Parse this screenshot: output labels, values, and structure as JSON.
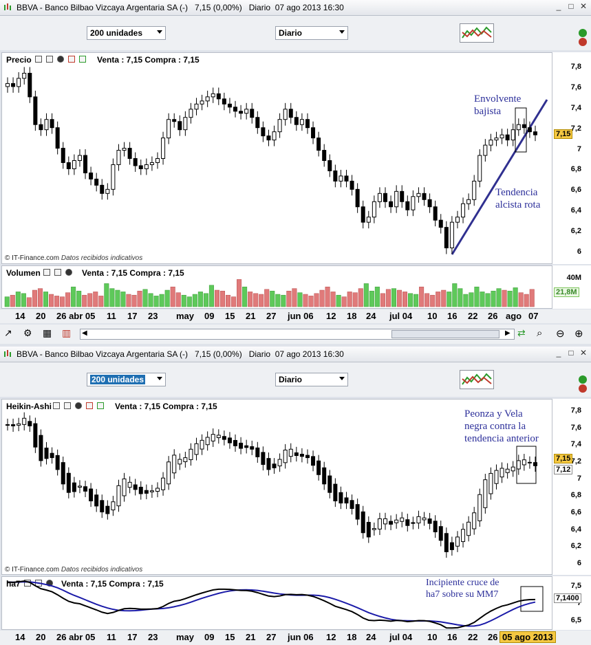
{
  "window1": {
    "title": "BBVA - Banco Bilbao Vizcaya Argentaria SA (-)   7,15 (0,00%)   Diario  07 ago 2013 16:30"
  },
  "window2": {
    "title": "BBVA - Banco Bilbao Vizcaya Argentaria SA (-)   7,15 (0,00%)   Diario  07 ago 2013 16:30"
  },
  "toolbar": {
    "units": "200 unidades",
    "period": "Diario"
  },
  "price_panel": {
    "header": "Precio",
    "quote": "Venta : 7,15 Compra : 7,15",
    "copyright": "© IT-Finance.com",
    "copyright_note": "Datos recibidos indicativos",
    "last_tag": "7,15"
  },
  "volume_panel": {
    "header": "Volumen",
    "quote": "Venta : 7,15 Compra : 7,15",
    "scale_label": "40M",
    "last_tag": "21,8M"
  },
  "heikin_panel": {
    "header": "Heikin-Ashi",
    "quote": "Venta : 7,15 Compra : 7,15",
    "copyright": "© IT-Finance.com",
    "copyright_note": "Datos recibidos indicativos",
    "last_tag": "7,15",
    "second_tag": "7,12"
  },
  "ha7_panel": {
    "header": "ha7",
    "quote": "Venta : 7,15 Compra : 7,15",
    "last_tag": "7,1400"
  },
  "annotations": {
    "envolvente": [
      "Envolvente",
      "bajista"
    ],
    "tendencia": [
      "Tendencia",
      "alcista rota"
    ],
    "peonza": [
      "Peonza y Vela",
      "negra contra la",
      "tendencia anterior"
    ],
    "cruce": [
      "Incipiente cruce de",
      "ha7 sobre su MM7"
    ]
  },
  "date_axis_labels": [
    "14",
    "20",
    "26 abr 05",
    "11",
    "17",
    "23",
    "may",
    "09",
    "15",
    "21",
    "27",
    "jun 06",
    "12",
    "18",
    "24",
    "jul 04",
    "10",
    "16",
    "22",
    "26",
    "ago",
    "07"
  ],
  "date_axis2_labels": [
    "14",
    "20",
    "26 abr 05",
    "11",
    "17",
    "23",
    "may",
    "09",
    "15",
    "21",
    "27",
    "jun 06",
    "12",
    "18",
    "24",
    "jul 04",
    "10",
    "16",
    "22",
    "26"
  ],
  "date_axis2_highlight": "05 ago 2013",
  "chart_data": [
    {
      "type": "candlestick",
      "title": "Precio",
      "yticks": [
        "7,8",
        "7,6",
        "7,4",
        "7,2",
        "7",
        "6,8",
        "6,6",
        "6,4",
        "6,2",
        "6"
      ],
      "ylim": [
        6.0,
        7.8
      ],
      "closes": [
        7.65,
        7.62,
        7.7,
        7.75,
        7.52,
        7.25,
        7.2,
        7.3,
        7.22,
        7.02,
        6.88,
        6.82,
        6.9,
        6.95,
        6.78,
        6.72,
        6.66,
        6.58,
        6.62,
        6.86,
        7.0,
        7.02,
        6.92,
        6.85,
        6.82,
        6.86,
        6.88,
        6.92,
        7.12,
        7.3,
        7.28,
        7.2,
        7.32,
        7.4,
        7.45,
        7.48,
        7.52,
        7.55,
        7.5,
        7.45,
        7.42,
        7.38,
        7.36,
        7.4,
        7.32,
        7.22,
        7.14,
        7.1,
        7.18,
        7.3,
        7.4,
        7.32,
        7.25,
        7.3,
        7.22,
        7.12,
        7.0,
        6.9,
        6.8,
        6.7,
        6.75,
        6.7,
        6.62,
        6.45,
        6.3,
        6.35,
        6.5,
        6.58,
        6.5,
        6.45,
        6.6,
        6.5,
        6.42,
        6.55,
        6.58,
        6.52,
        6.45,
        6.32,
        6.25,
        6.05,
        6.3,
        6.35,
        6.48,
        6.52,
        6.7,
        6.95,
        7.05,
        7.1,
        7.12,
        7.15,
        7.1,
        7.2,
        7.25,
        7.22,
        7.18,
        7.15
      ]
    },
    {
      "type": "bar",
      "title": "Volumen",
      "ylim": [
        0,
        40000000
      ],
      "last": 21800000,
      "values": [
        12,
        14,
        18,
        16,
        11,
        20,
        22,
        18,
        15,
        13,
        12,
        17,
        24,
        19,
        14,
        16,
        18,
        13,
        28,
        22,
        20,
        18,
        15,
        14,
        19,
        21,
        16,
        13,
        15,
        20,
        24,
        17,
        14,
        12,
        15,
        18,
        16,
        26,
        20,
        19,
        14,
        12,
        33,
        24,
        18,
        16,
        15,
        21,
        19,
        15,
        14,
        19,
        22,
        17,
        15,
        13,
        16,
        20,
        24,
        18,
        14,
        12,
        18,
        17,
        22,
        28,
        19,
        24,
        16,
        21,
        22,
        20,
        18,
        16,
        15,
        24,
        16,
        14,
        18,
        20,
        18,
        28,
        22,
        15,
        17,
        24,
        18,
        16,
        19,
        22,
        20,
        19,
        23,
        17,
        15,
        21
      ]
    },
    {
      "type": "candlestick",
      "title": "Heikin-Ashi",
      "yticks": [
        "7,8",
        "7,6",
        "7,4",
        "7,2",
        "7",
        "6,8",
        "6,6",
        "6,4",
        "6,2",
        "6"
      ],
      "ylim": [
        6.0,
        7.8
      ]
    },
    {
      "type": "line",
      "title": "ha7",
      "yticks": [
        "7,5",
        "7",
        "6,5"
      ],
      "ylim": [
        6.4,
        7.6
      ],
      "last": 7.14
    }
  ]
}
